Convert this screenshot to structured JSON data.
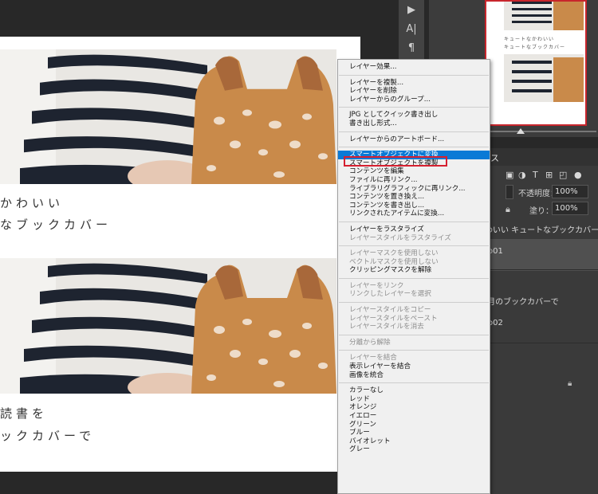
{
  "document": {
    "caption1_line1": "かわいい",
    "caption1_line2": "なブックカバー",
    "caption2_line1": "読書を",
    "caption2_line2": "ックカバーで"
  },
  "tools": [
    "▶",
    "A|",
    "¶"
  ],
  "navigator": {
    "thumb_line1": "キュートなかわいい",
    "thumb_line2": "キュートなブックカバー"
  },
  "layers": {
    "tab_label": "パス",
    "opacity_label": "不透明度：",
    "opacity_value": "100%",
    "fill_label": "塗り：",
    "fill_value": "100%",
    "rows": [
      "かわいい キュートなブックカバー",
      "o01",
      "を 月のブックカバーで",
      "o02",
      "i"
    ]
  },
  "context_menu": {
    "groups": [
      [
        {
          "label": "レイヤー効果...",
          "disabled": false
        }
      ],
      [
        {
          "label": "レイヤーを複製...",
          "disabled": false
        },
        {
          "label": "レイヤーを削除",
          "disabled": false
        },
        {
          "label": "レイヤーからのグループ...",
          "disabled": false
        }
      ],
      [
        {
          "label": "JPG としてクイック書き出し",
          "disabled": false
        },
        {
          "label": "書き出し形式...",
          "disabled": false
        }
      ],
      [
        {
          "label": "レイヤーからのアートボード...",
          "disabled": false
        }
      ],
      [
        {
          "label": "スマートオブジェクトに変換",
          "disabled": false,
          "selected": true
        },
        {
          "label": "スマートオブジェクトを複製",
          "disabled": false
        },
        {
          "label": "コンテンツを編集",
          "disabled": false
        },
        {
          "label": "ファイルに再リンク...",
          "disabled": false
        },
        {
          "label": "ライブラリグラフィックに再リンク...",
          "disabled": false
        },
        {
          "label": "コンテンツを置き換え...",
          "disabled": false
        },
        {
          "label": "コンテンツを書き出し...",
          "disabled": false
        },
        {
          "label": "リンクされたアイテムに変換...",
          "disabled": false
        }
      ],
      [
        {
          "label": "レイヤーをラスタライズ",
          "disabled": false
        },
        {
          "label": "レイヤースタイルをラスタライズ",
          "disabled": true
        }
      ],
      [
        {
          "label": "レイヤーマスクを使用しない",
          "disabled": true
        },
        {
          "label": "ベクトルマスクを使用しない",
          "disabled": true
        },
        {
          "label": "クリッピングマスクを解除",
          "disabled": false
        }
      ],
      [
        {
          "label": "レイヤーをリンク",
          "disabled": true
        },
        {
          "label": "リンクしたレイヤーを選択",
          "disabled": true
        }
      ],
      [
        {
          "label": "レイヤースタイルをコピー",
          "disabled": true
        },
        {
          "label": "レイヤースタイルをペースト",
          "disabled": true
        },
        {
          "label": "レイヤースタイルを消去",
          "disabled": true
        }
      ],
      [
        {
          "label": "分離から解除",
          "disabled": true
        }
      ],
      [
        {
          "label": "レイヤーを結合",
          "disabled": true
        },
        {
          "label": "表示レイヤーを結合",
          "disabled": false
        },
        {
          "label": "画像を統合",
          "disabled": false
        }
      ],
      [
        {
          "label": "カラーなし",
          "disabled": false
        },
        {
          "label": "レッド",
          "disabled": false
        },
        {
          "label": "オレンジ",
          "disabled": false
        },
        {
          "label": "イエロー",
          "disabled": false
        },
        {
          "label": "グリーン",
          "disabled": false
        },
        {
          "label": "ブルー",
          "disabled": false
        },
        {
          "label": "バイオレット",
          "disabled": false
        },
        {
          "label": "グレー",
          "disabled": false
        }
      ]
    ]
  },
  "colors": {
    "selection": "#0a7ad6",
    "highlight_border": "#d62030",
    "panel_bg": "#3a3a3a",
    "workspace_bg": "#282828"
  }
}
